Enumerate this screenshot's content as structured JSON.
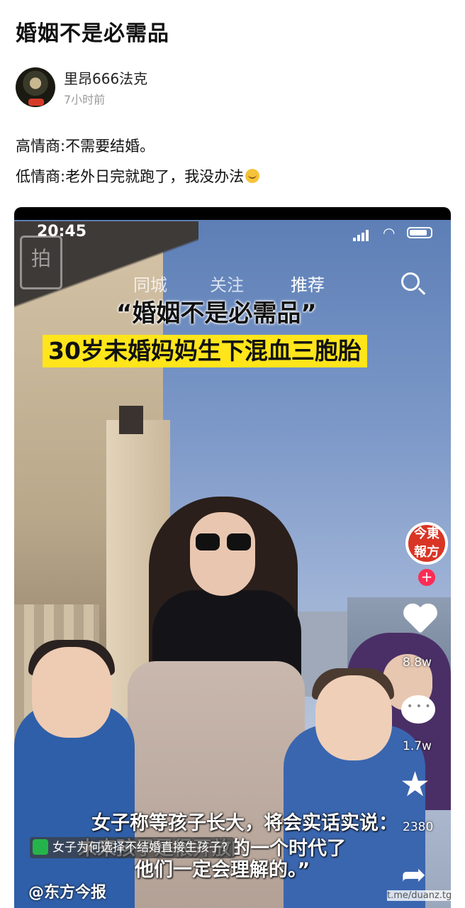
{
  "post": {
    "title": "婚姻不是必需品",
    "author_name": "里昂666法克",
    "time": "7小时前",
    "line1": "高情商:不需要结婚。",
    "line2": "低情商:老外日完就跑了，我没办法"
  },
  "video": {
    "status_time": "20:45",
    "nav_tabs": [
      "同城",
      "关注",
      "推荐"
    ],
    "headline": "“婚姻不是必需品”",
    "subhead": "30岁未婚妈妈生下混血三胞胎",
    "logo_text": "今東 報方",
    "likes": "8.8w",
    "comments": "1.7w",
    "favorites": "2380",
    "caption_line1": "女子称等孩子长大，将会实话实说：",
    "caption_line_mid": "未来孩子是很开放的一个时代了",
    "caption_line2": "他们一定会理解的。”",
    "tag_text": "女子为何选择不结婚直接生孩子?",
    "account": "@东方今报"
  },
  "watermark": "t.me/duanz.tg",
  "colors": {
    "caption_highlight": "#ffe51a",
    "like_accent": "#fe2c55",
    "logo_red": "#d93525"
  }
}
